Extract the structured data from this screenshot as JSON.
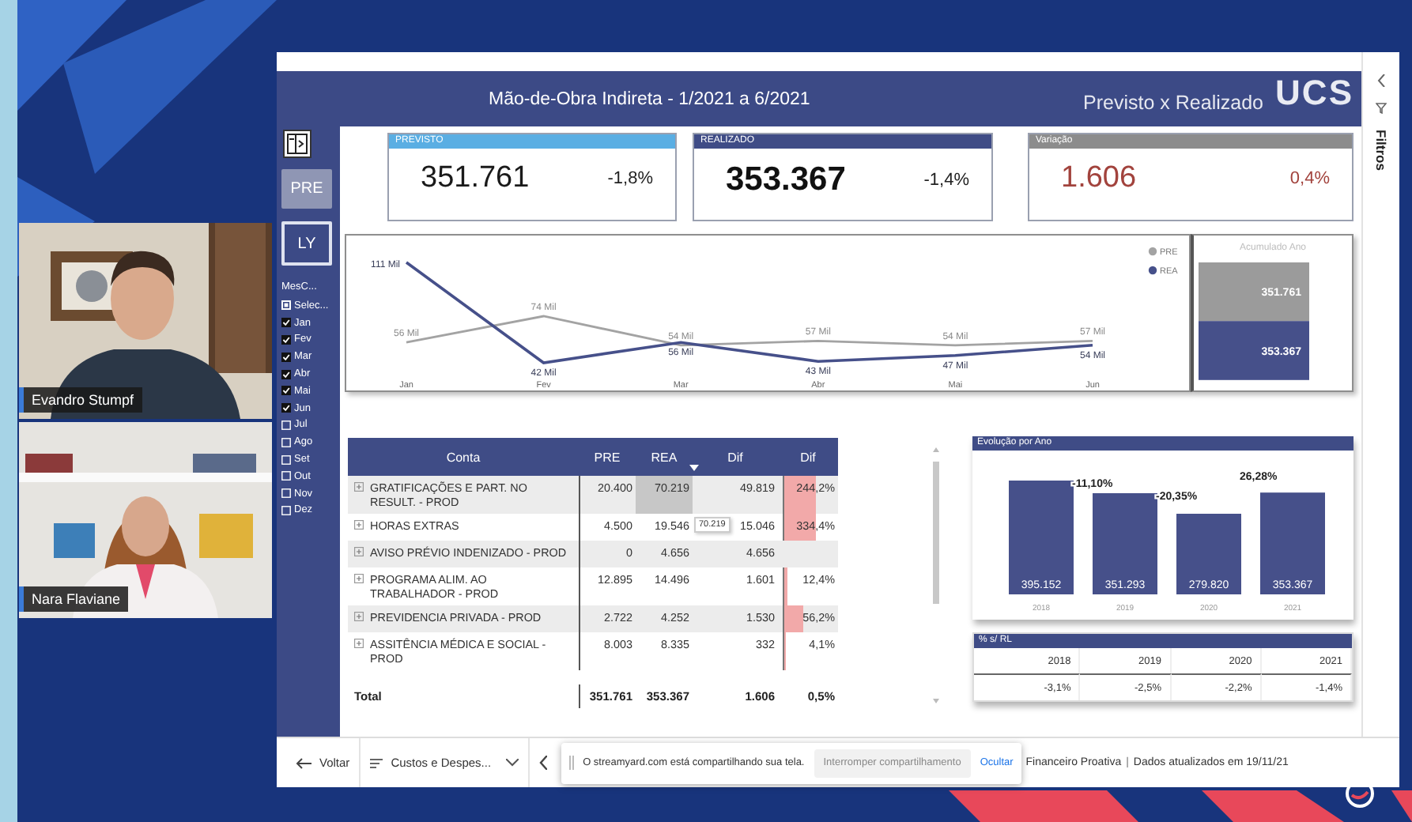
{
  "video_tiles": [
    {
      "name": "Evandro Stumpf"
    },
    {
      "name": "Nara Flaviane"
    }
  ],
  "report": {
    "title": "Mão-de-Obra Indireta - 1/2021 a 6/2021",
    "subtitle": "Previsto x Realizado",
    "logo": "UCS",
    "nav_buttons": [
      {
        "label": "PRE",
        "selected": true
      },
      {
        "label": "LY",
        "selected": false
      }
    ],
    "slicer": {
      "title": "MesC...",
      "items": [
        {
          "label": "Selec...",
          "kind": "select_all",
          "partial": true
        },
        {
          "label": "Jan",
          "kind": "month",
          "checked": true
        },
        {
          "label": "Fev",
          "kind": "month",
          "checked": true
        },
        {
          "label": "Mar",
          "kind": "month",
          "checked": true
        },
        {
          "label": "Abr",
          "kind": "month",
          "checked": true
        },
        {
          "label": "Mai",
          "kind": "month",
          "checked": true
        },
        {
          "label": "Jun",
          "kind": "month",
          "checked": true
        },
        {
          "label": "Jul",
          "kind": "month",
          "checked": false
        },
        {
          "label": "Ago",
          "kind": "month",
          "checked": false
        },
        {
          "label": "Set",
          "kind": "month",
          "checked": false
        },
        {
          "label": "Out",
          "kind": "month",
          "checked": false
        },
        {
          "label": "Nov",
          "kind": "month",
          "checked": false
        },
        {
          "label": "Dez",
          "kind": "month",
          "checked": false
        }
      ]
    },
    "kpis": [
      {
        "kind": "previsto",
        "label": "PREVISTO",
        "value": "351.761",
        "change": "-1,8%"
      },
      {
        "kind": "realizado",
        "label": "REALIZADO",
        "value": "353.367",
        "change": "-1,4%"
      },
      {
        "kind": "variacao",
        "label": "Variação",
        "value": "1.606",
        "change": "0,4%"
      }
    ],
    "monthly_chart": {
      "chart_data": {
        "type": "line",
        "categories": [
          "Jan",
          "Fev",
          "Mar",
          "Abr",
          "Mai",
          "Jun"
        ],
        "data_labels": true,
        "legend": "top-right",
        "series": [
          {
            "name": "PRE",
            "color": "#a3a3a3",
            "values": [
              56,
              74,
              54,
              57,
              54,
              57
            ],
            "value_labels": [
              "56 Mil",
              "74 Mil",
              "54 Mil",
              "57 Mil",
              "54 Mil",
              "57 Mil"
            ]
          },
          {
            "name": "REA",
            "color": "#46508a",
            "values": [
              111,
              42,
              56,
              43,
              47,
              54
            ],
            "value_labels": [
              "111 Mil",
              "42 Mil",
              "56 Mil",
              "43 Mil",
              "47 Mil",
              "54 Mil"
            ]
          }
        ]
      }
    },
    "accumulated_chart": {
      "chart_data": {
        "type": "bar",
        "title": "Acumulado Ano",
        "stacked": true,
        "data_labels": true,
        "series": [
          {
            "color": "#9b9b9b",
            "values": [
              351761
            ],
            "value_labels": [
              "351.761"
            ]
          },
          {
            "color": "#46508a",
            "values": [
              353367
            ],
            "value_labels": [
              "353.367"
            ]
          }
        ]
      }
    },
    "table": {
      "columns": [
        {
          "label": "Conta",
          "sorted": false
        },
        {
          "label": "PRE",
          "sorted": false
        },
        {
          "label": "REA",
          "sorted": true
        },
        {
          "label": "Dif",
          "sorted": false
        },
        {
          "label": "Dif",
          "sorted": false
        }
      ],
      "rows": [
        {
          "conta": "GRATIFICAÇÕES E PART. NO RESULT. - PROD",
          "pre": "20.400",
          "rea": "70.219",
          "dif": "49.819",
          "dif_pct": "244,2%",
          "level": 0.6,
          "selected": true
        },
        {
          "conta": "HORAS EXTRAS",
          "pre": "4.500",
          "rea": "19.546",
          "dif": "15.046",
          "dif_pct": "334,4%",
          "level": 0.6,
          "selected": false
        },
        {
          "conta": "AVISO PRÉVIO INDENIZADO - PROD",
          "pre": "0",
          "rea": "4.656",
          "dif": "4.656",
          "selected": false
        },
        {
          "conta": "PROGRAMA ALIM. AO TRABALHADOR - PROD",
          "pre": "12.895",
          "rea": "14.496",
          "dif": "1.601",
          "dif_pct": "12,4%",
          "level": 0.05,
          "selected": false
        },
        {
          "conta": "PREVIDENCIA PRIVADA - PROD",
          "pre": "2.722",
          "rea": "4.252",
          "dif": "1.530",
          "dif_pct": "56,2%",
          "level": 0.35,
          "selected": false
        },
        {
          "conta": "ASSITÊNCIA MÉDICA E SOCIAL - PROD",
          "pre": "8.003",
          "rea": "8.335",
          "dif": "332",
          "dif_pct": "4,1%",
          "level": 0.03,
          "selected": false
        }
      ],
      "total": {
        "label": "Total",
        "pre": "351.761",
        "rea": "353.367",
        "dif": "1.606",
        "dif_pct": "0,5%"
      },
      "tooltip": "70.219"
    },
    "yearly_chart": {
      "title": "Evolução por Ano",
      "chart_data": {
        "type": "bar",
        "categories": [
          "2018",
          "2019",
          "2020",
          "2021"
        ],
        "values": [
          395152,
          351293,
          279820,
          353367
        ],
        "value_labels": [
          "395.152",
          "351.293",
          "279.820",
          "353.367"
        ],
        "data_labels": true,
        "annotations": [
          "-11,10%",
          "-20,35%",
          "26,28%"
        ]
      }
    },
    "ratio_table": {
      "title": "% s/ RL",
      "columns": [
        "2018",
        "2019",
        "2020",
        "2021"
      ],
      "values": [
        "-3,1%",
        "-2,5%",
        "-2,2%",
        "-1,4%"
      ]
    },
    "filters_pane": {
      "label": "Filtros"
    }
  },
  "bottom_bar": {
    "back": "Voltar",
    "page": "Custos e Despes...",
    "brand": "Financeiro Proativa",
    "separator": "|",
    "updated": "Dados atualizados em 19/11/21"
  },
  "share_notice": {
    "message": "O streamyard.com está compartilhando sua tela.",
    "stop_button": "Interromper compartilhamento",
    "hide_link": "Ocultar"
  }
}
